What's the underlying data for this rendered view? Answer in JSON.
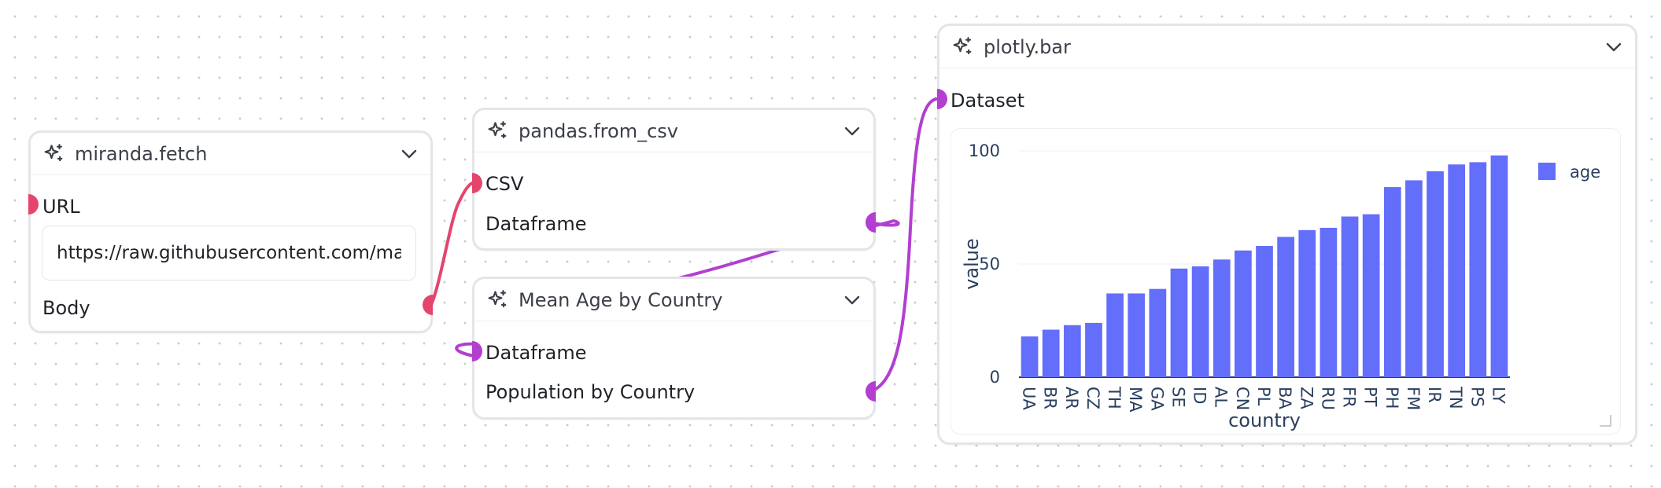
{
  "colors": {
    "pink": "#e5456d",
    "purple": "#b23fd0",
    "bar": "#636efa"
  },
  "nodes": {
    "fetch": {
      "title": "miranda.fetch",
      "icon": "sparkles-icon",
      "ports": {
        "url": "URL",
        "body": "Body"
      },
      "url_value": "https://raw.githubusercontent.com/main/data.csv"
    },
    "csv": {
      "title": "pandas.from_csv",
      "icon": "sparkles-icon",
      "ports": {
        "csv": "CSV",
        "dataframe": "Dataframe"
      }
    },
    "mean": {
      "title": "Mean Age by Country",
      "icon": "sparkles-icon",
      "ports": {
        "dataframe": "Dataframe",
        "population": "Population by Country"
      }
    },
    "plot": {
      "title": "plotly.bar",
      "icon": "sparkles-icon",
      "ports": {
        "dataset": "Dataset"
      }
    }
  },
  "chart_data": {
    "type": "bar",
    "xlabel": "country",
    "ylabel": "value",
    "ylim": [
      0,
      100
    ],
    "yticks": [
      0,
      50,
      100
    ],
    "legend_position": "top-right",
    "categories": [
      "UA",
      "BR",
      "AR",
      "CZ",
      "TH",
      "MA",
      "GA",
      "SE",
      "ID",
      "AL",
      "CN",
      "PL",
      "BA",
      "ZA",
      "RU",
      "FR",
      "PT",
      "PH",
      "FM",
      "IR",
      "TN",
      "PS",
      "LY"
    ],
    "series": [
      {
        "name": "age",
        "values": [
          18,
          21,
          23,
          24,
          37,
          37,
          39,
          48,
          49,
          52,
          56,
          58,
          62,
          65,
          66,
          71,
          72,
          84,
          87,
          91,
          94,
          95,
          98
        ]
      }
    ]
  }
}
